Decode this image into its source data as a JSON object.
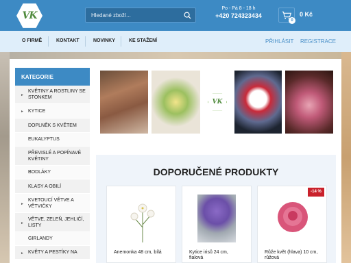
{
  "header": {
    "logo_text": "VK",
    "search_placeholder": "Hledané zboží...",
    "opening_hours": "Po - Pá 8 - 18 h",
    "phone": "+420 724323434",
    "cart_count": "0",
    "cart_total": "0 Kč"
  },
  "nav": {
    "items": [
      "O FIRMĚ",
      "KONTAKT",
      "NOVINKY",
      "KE STAŽENÍ"
    ],
    "login": "PŘIHLÁSIT",
    "register": "REGISTRACE"
  },
  "sidebar": {
    "title": "KATEGORIE",
    "items": [
      "KVĚTINY A ROSTLINY SE STONKEM",
      "KYTICE",
      "DOPLNĚK S KVĚTEM",
      "EUKALYPTUS",
      "PŘEVISLÉ A POPÍNAVÉ KVĚTINY",
      "BODLÁKY",
      "KLASY A OBILÍ",
      "KVETOUCÍ VĚTVE A VĚTVIČKY",
      "VĚTVE, ZELEŇ, JEHLIČÍ, LISTY",
      "GIRLANDY",
      "KVĚTY A PESTÍKY NA"
    ]
  },
  "banner_logo_text": "VK",
  "featured": {
    "title": "DOPORUČENÉ PRODUKTY",
    "products": [
      {
        "name_line1": "Anemonka 48 cm, bílá",
        "name_line2": ""
      },
      {
        "name_line1": "Kytice irisů 24 cm,",
        "name_line2": "fialová"
      },
      {
        "name_line1": "Růže květ (hlava) 10 cm,",
        "name_line2": "růžová",
        "discount": "-14 %"
      }
    ]
  },
  "colors": {
    "primary": "#3d8ac4",
    "nav_bg": "#dfeefa",
    "discount": "#c9212b"
  }
}
